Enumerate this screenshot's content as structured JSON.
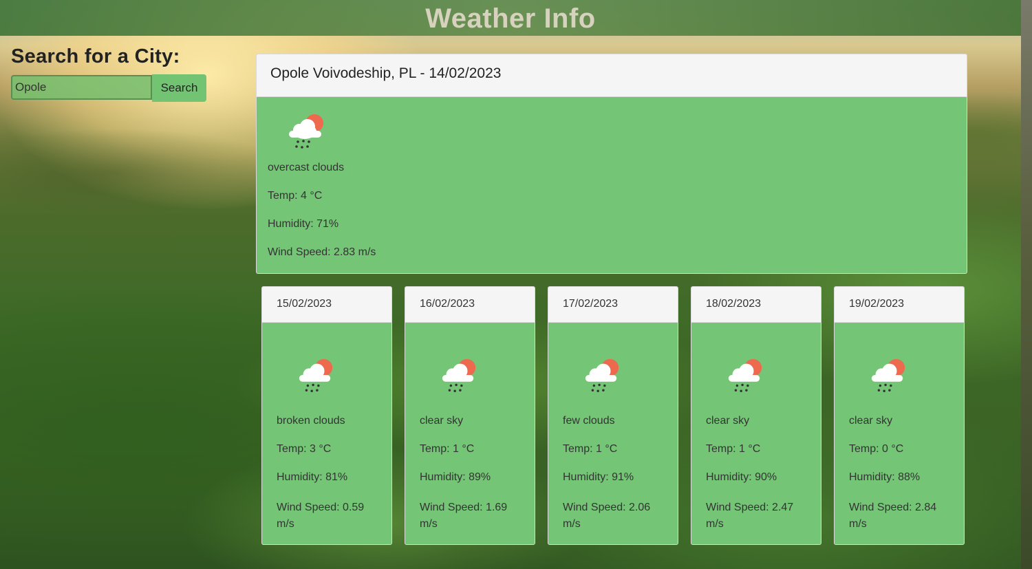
{
  "app": {
    "title": "Weather Info"
  },
  "search": {
    "heading": "Search for a City:",
    "input_value": "Opole",
    "button_label": "Search"
  },
  "current": {
    "title": "Opole Voivodeship, PL - 14/02/2023",
    "icon": "cloud-sun-rain-icon",
    "description": "overcast clouds",
    "temp": "Temp: 4 °C",
    "humidity": "Humidity: 71%",
    "wind": "Wind Speed: 2.83 m/s"
  },
  "forecast": [
    {
      "date": "15/02/2023",
      "icon": "cloud-sun-rain-icon",
      "description": "broken clouds",
      "temp": "Temp: 3 °C",
      "humidity": "Humidity: 81%",
      "wind": "Wind Speed: 0.59 m/s"
    },
    {
      "date": "16/02/2023",
      "icon": "cloud-sun-rain-icon",
      "description": "clear sky",
      "temp": "Temp: 1 °C",
      "humidity": "Humidity: 89%",
      "wind": "Wind Speed: 1.69 m/s"
    },
    {
      "date": "17/02/2023",
      "icon": "cloud-sun-rain-icon",
      "description": "few clouds",
      "temp": "Temp: 1 °C",
      "humidity": "Humidity: 91%",
      "wind": "Wind Speed: 2.06 m/s"
    },
    {
      "date": "18/02/2023",
      "icon": "cloud-sun-rain-icon",
      "description": "clear sky",
      "temp": "Temp: 1 °C",
      "humidity": "Humidity: 90%",
      "wind": "Wind Speed: 2.47 m/s"
    },
    {
      "date": "19/02/2023",
      "icon": "cloud-sun-rain-icon",
      "description": "clear sky",
      "temp": "Temp: 0 °C",
      "humidity": "Humidity: 88%",
      "wind": "Wind Speed: 2.84 m/s"
    }
  ],
  "colors": {
    "card_green": "#75c576",
    "header_bar": "#4f8a44",
    "card_header": "#f5f5f5",
    "sun": "#ee6a4f"
  }
}
